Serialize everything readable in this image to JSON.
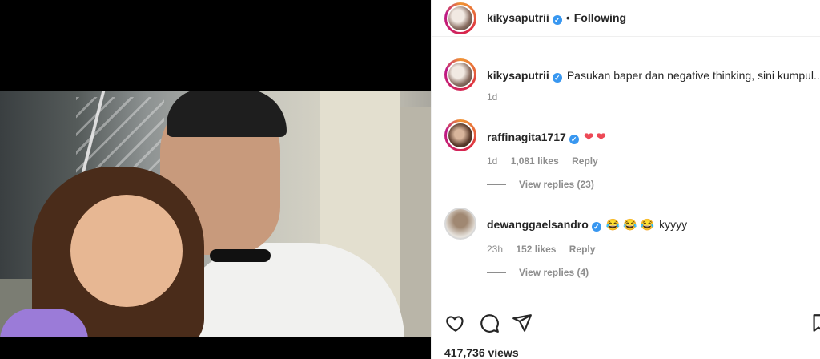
{
  "header": {
    "username": "kikysaputrii",
    "separator": "•",
    "follow_status": "Following"
  },
  "caption": {
    "username": "kikysaputrii",
    "text": "Pasukan baper dan negative thinking, sini kumpul..",
    "time": "1d"
  },
  "comments": [
    {
      "username": "raffinagita1717",
      "text": "",
      "hearts": [
        "❤",
        "❤"
      ],
      "time": "1d",
      "likes": "1,081 likes",
      "reply_label": "Reply",
      "view_replies": "View replies (23)"
    },
    {
      "username": "dewanggaelsandro",
      "emojis": [
        "😂",
        "😂",
        "😂"
      ],
      "text": "kyyyy",
      "time": "23h",
      "likes": "152 likes",
      "reply_label": "Reply",
      "view_replies": "View replies (4)"
    }
  ],
  "actions": {
    "icons": [
      "heart-icon",
      "comment-icon",
      "share-icon",
      "bookmark-icon"
    ]
  },
  "stats": {
    "views": "417,736 views"
  },
  "colors": {
    "verified": "#3897f0",
    "heart": "#ed4956",
    "muted_text": "#8e8e8e",
    "primary_text": "#262626"
  }
}
